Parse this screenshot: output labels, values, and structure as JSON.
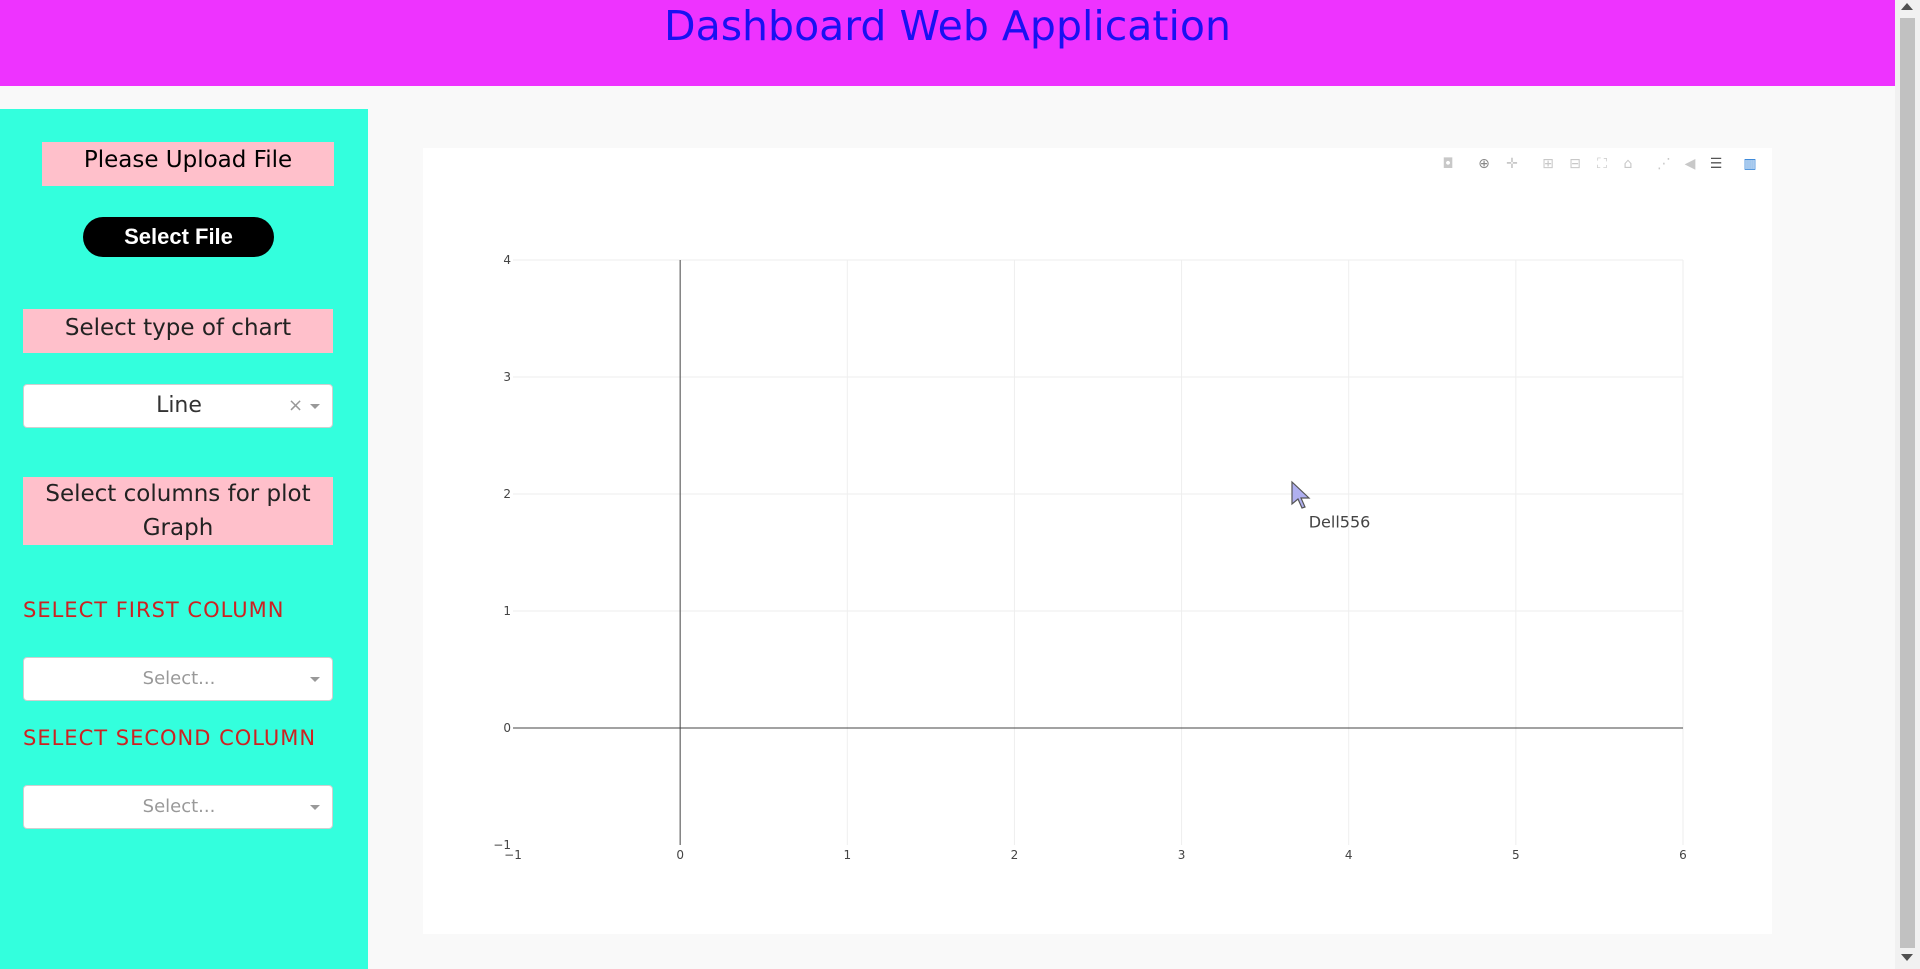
{
  "header": {
    "title": "Dashboard Web Application"
  },
  "sidebar": {
    "upload_label": "Please Upload File",
    "select_file_button": "Select File",
    "chart_type_label": "Select type of chart",
    "chart_type_value": "Line",
    "chart_type_clear": "×",
    "columns_label": "Select columns for plot Graph",
    "first_column_heading": "SELECT FIRST COLUMN",
    "first_column_placeholder": "Select...",
    "second_column_heading": "SELECT SECOND COLUMN",
    "second_column_placeholder": "Select..."
  },
  "modebar": {
    "icons": [
      "camera-icon",
      "zoom-icon",
      "pan-icon",
      "zoom-in-icon",
      "zoom-out-icon",
      "autoscale-icon",
      "reset-axes-icon",
      "spike-lines-icon",
      "hover-closest-icon",
      "hover-compare-icon",
      "plotly-logo-icon"
    ]
  },
  "chart_data": {
    "type": "line",
    "xlim": [
      -1,
      6
    ],
    "ylim": [
      -1,
      4
    ],
    "x_ticks": [
      "−1",
      "0",
      "1",
      "2",
      "3",
      "4",
      "5",
      "6"
    ],
    "y_ticks": [
      "−1",
      "0",
      "1",
      "2",
      "3",
      "4"
    ],
    "annotation": {
      "text": "Dell556",
      "x": 4,
      "y": 1.8
    },
    "grid": true
  },
  "colors": {
    "header_bg": "#ee33ff",
    "title": "#1a10f2",
    "sidebar_bg": "#33ffdd",
    "label_bg": "#ffc0cb",
    "column_heading": "#cc2222"
  }
}
